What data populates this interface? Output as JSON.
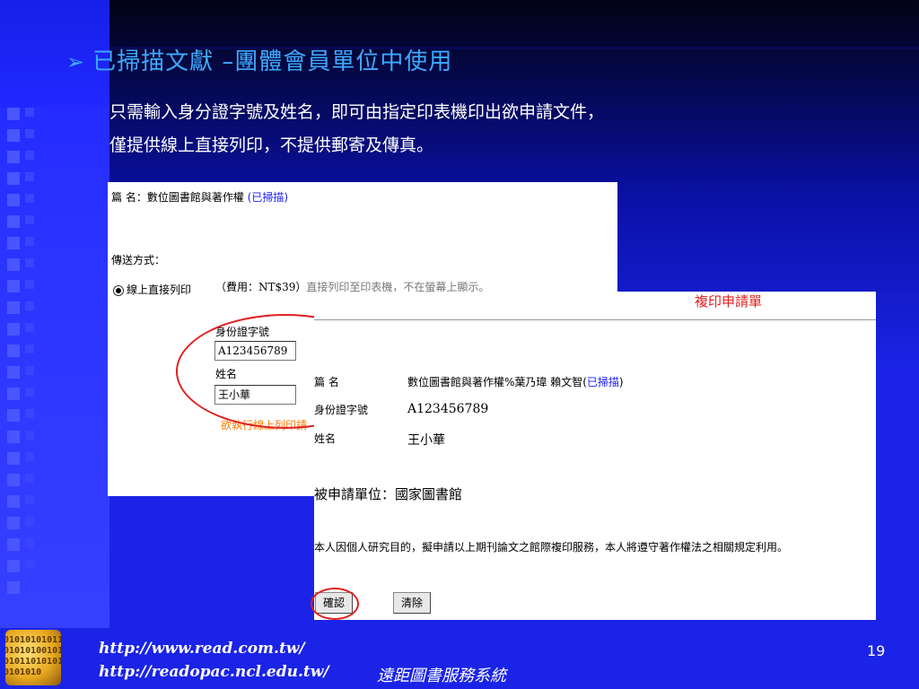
{
  "slide": {
    "title": "已掃描文獻 –團體會員單位中使用",
    "desc_line1": "只需輸入身分證字號及姓名，即可由指定印表機印出欲申請文件，",
    "desc_line2": "僅提供線上直接列印，不提供郵寄及傳真。"
  },
  "panel1": {
    "title_prefix": "篇 名：數位圖書館與著作權 ",
    "title_scanned": "(已掃描)",
    "delivery_label": "傳送方式：",
    "radio_label": "線上直接列印",
    "fee_text": "（費用：NT$39）",
    "fee_note": "直接列印至印表機，不在螢幕上顯示。",
    "id_label": "身份證字號",
    "id_value": "A123456789",
    "name_label": "姓名",
    "name_value": "王小華",
    "orange_text": "欲執行線上列印請"
  },
  "panel2": {
    "header": "複印申請單",
    "rows": [
      {
        "label": "篇 名",
        "value": "數位圖書館與著作權%葉乃瑋 賴文智(",
        "scanned": "已掃描",
        "suffix": ")"
      },
      {
        "label": "身份證字號",
        "value": "A123456789"
      },
      {
        "label": "姓名",
        "value": "王小華"
      }
    ],
    "unit": "被申請單位：國家圖書館",
    "statement": "本人因個人研究目的，擬申請以上期刊論文之館際複印服務，本人將遵守著作權法之相關規定利用。",
    "confirm_label": "確認",
    "clear_label": "清除"
  },
  "footer": {
    "url1": "http://www.read.com.tw/",
    "url2": "http://readopac.ncl.edu.tw/",
    "system_name": "遠距圖書服務系統",
    "page_number": "19",
    "logo_digits": "0101010101101010100101010110101010101010"
  },
  "colors": {
    "background": "#1b24e6",
    "title": "#3fa9ff",
    "annotation_red": "#e02020",
    "scanned_link": "#1a1aff",
    "orange_note": "#ff7a00"
  }
}
